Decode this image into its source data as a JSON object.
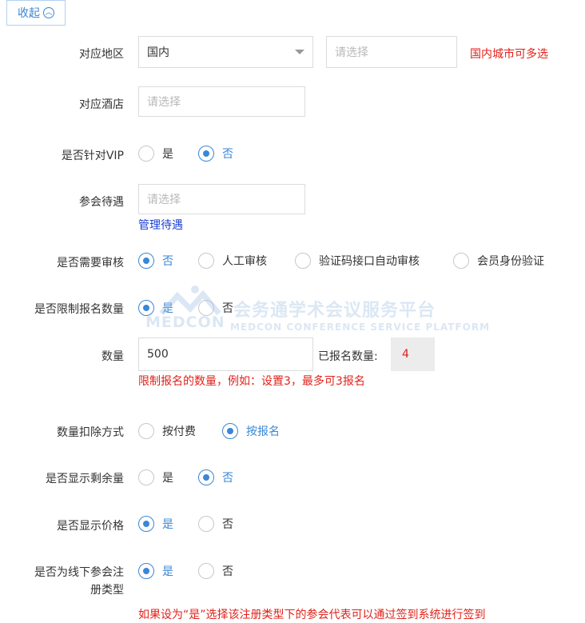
{
  "collapse": {
    "label": "收起"
  },
  "region": {
    "label": "对应地区",
    "select_value": "国内",
    "city_placeholder": "请选择",
    "hint": "国内城市可多选"
  },
  "hotel": {
    "label": "对应酒店",
    "placeholder": "请选择"
  },
  "vip": {
    "label": "是否针对VIP",
    "options": [
      "是",
      "否"
    ],
    "selected": "否"
  },
  "treatment": {
    "label": "参会待遇",
    "placeholder": "请选择",
    "manage_link": "管理待遇"
  },
  "review": {
    "label": "是否需要审核",
    "options": [
      "否",
      "人工审核",
      "验证码接口自动审核",
      "会员身份验证"
    ],
    "selected": "否"
  },
  "limit": {
    "label": "是否限制报名数量",
    "options": [
      "是",
      "否"
    ],
    "selected": "是"
  },
  "quantity": {
    "label": "数量",
    "value": "500",
    "registered_label": "已报名数量:",
    "registered_count": "4",
    "hint": "限制报名的数量，例如：设置3，最多可3报名"
  },
  "deduct": {
    "label": "数量扣除方式",
    "options": [
      "按付费",
      "按报名"
    ],
    "selected": "按报名"
  },
  "remaining": {
    "label": "是否显示剩余量",
    "options": [
      "是",
      "否"
    ],
    "selected": "否"
  },
  "price": {
    "label": "是否显示价格",
    "options": [
      "是",
      "否"
    ],
    "selected": "是"
  },
  "offline": {
    "label_line1": "是否为线下参会注",
    "label_line2": "册类型",
    "options": [
      "是",
      "否"
    ],
    "selected": "是",
    "hint": "如果设为“是”选择该注册类型下的参会代表可以通过签到系统进行签到"
  },
  "watermark": {
    "cn": "会务通学术会议服务平台",
    "logo": "MEDCON",
    "en": "MEDCON CONFERENCE SERVICE PLATFORM"
  },
  "colors": {
    "accent": "#3a87d6",
    "danger": "#e0221a",
    "link": "#1a3fd6"
  }
}
